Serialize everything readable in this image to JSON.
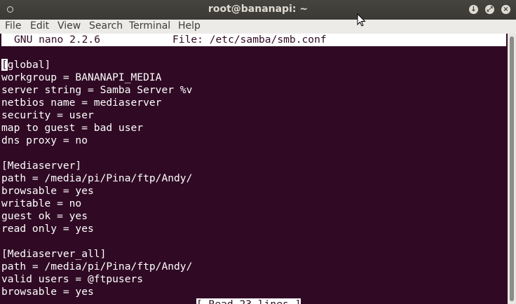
{
  "titlebar": {
    "title": "root@bananapi: ~"
  },
  "menubar": {
    "items": [
      "File",
      "Edit",
      "View",
      "Search",
      "Terminal",
      "Help"
    ]
  },
  "nano": {
    "program": "GNU nano 2.2.6",
    "file_label": "File: /etc/samba/smb.conf",
    "cursor_char": "[",
    "lines": [
      "global]",
      "workgroup = BANANAPI_MEDIA",
      "server string = Samba Server %v",
      "netbios name = mediaserver",
      "security = user",
      "map to guest = bad user",
      "dns proxy = no",
      "",
      "[Mediaserver]",
      "path = /media/pi/Pina/ftp/Andy/",
      "browsable = yes",
      "writable = no",
      "guest ok = yes",
      "read only = yes",
      "",
      "[Mediaserver_all]",
      "path = /media/pi/Pina/ftp/Andy/",
      "valid users = @ftpusers",
      "browsable = yes"
    ],
    "status": "[ Read 23 lines ]"
  }
}
